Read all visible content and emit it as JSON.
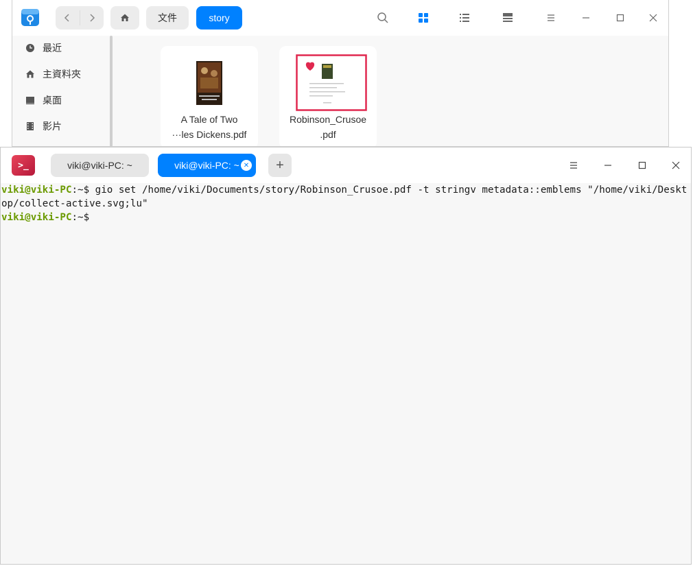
{
  "file_manager": {
    "breadcrumb": [
      "文件",
      "story"
    ],
    "sidebar": [
      {
        "label": "最近",
        "icon": "clock-icon"
      },
      {
        "label": "主資料夾",
        "icon": "home-icon"
      },
      {
        "label": "桌面",
        "icon": "desktop-icon"
      },
      {
        "label": "影片",
        "icon": "video-icon"
      }
    ],
    "files": [
      {
        "name_line1": "A Tale of Two",
        "name_line2": "···les Dickens.pdf"
      },
      {
        "name_line1": "Robinson_Crusoe",
        "name_line2": ".pdf"
      }
    ],
    "accent": "#0081ff"
  },
  "terminal": {
    "tabs": [
      "viki@viki-PC: ~",
      "viki@viki-PC: ~"
    ],
    "active_tab_index": 1,
    "lines": [
      {
        "user": "viki@viki-PC",
        "sep": ":~$ ",
        "command": "gio set /home/viki/Documents/story/Robinson_Crusoe.pdf -t stringv metadata::emblems \"/home/viki/Desktop/collect-active.svg;lu\""
      },
      {
        "user": "viki@viki-PC",
        "sep": ":~$ ",
        "command": ""
      }
    ],
    "prompt_color": "#6b9a00"
  }
}
